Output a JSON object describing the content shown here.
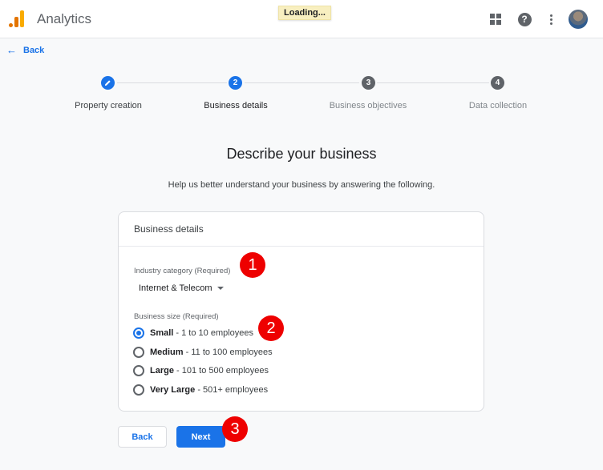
{
  "header": {
    "app_title": "Analytics",
    "loading_text": "Loading...",
    "icons": [
      "apps-icon",
      "help-icon",
      "more-vert-icon",
      "avatar"
    ]
  },
  "back_link": {
    "label": "Back"
  },
  "stepper": {
    "steps": [
      {
        "label": "Property creation",
        "marker": "",
        "state": "completed"
      },
      {
        "label": "Business details",
        "marker": "2",
        "state": "current"
      },
      {
        "label": "Business objectives",
        "marker": "3",
        "state": "upcoming"
      },
      {
        "label": "Data collection",
        "marker": "4",
        "state": "upcoming"
      }
    ]
  },
  "main": {
    "title": "Describe your business",
    "subtitle": "Help us better understand your business by answering the following."
  },
  "card": {
    "heading": "Business details",
    "industry": {
      "label": "Industry category (Required)",
      "selected": "Internet & Telecom"
    },
    "size": {
      "label": "Business size (Required)",
      "options": [
        {
          "name": "Small",
          "detail": " - 1 to 10 employees",
          "checked": true
        },
        {
          "name": "Medium",
          "detail": " - 11 to 100 employees",
          "checked": false
        },
        {
          "name": "Large",
          "detail": " - 101 to 500 employees",
          "checked": false
        },
        {
          "name": "Very Large",
          "detail": " - 501+ employees",
          "checked": false
        }
      ]
    }
  },
  "buttons": {
    "back": "Back",
    "next": "Next"
  },
  "annotations": [
    "1",
    "2",
    "3"
  ],
  "colors": {
    "accent": "#1a73e8",
    "badge": "#ee0000",
    "loading_bg": "#f8efc0"
  }
}
